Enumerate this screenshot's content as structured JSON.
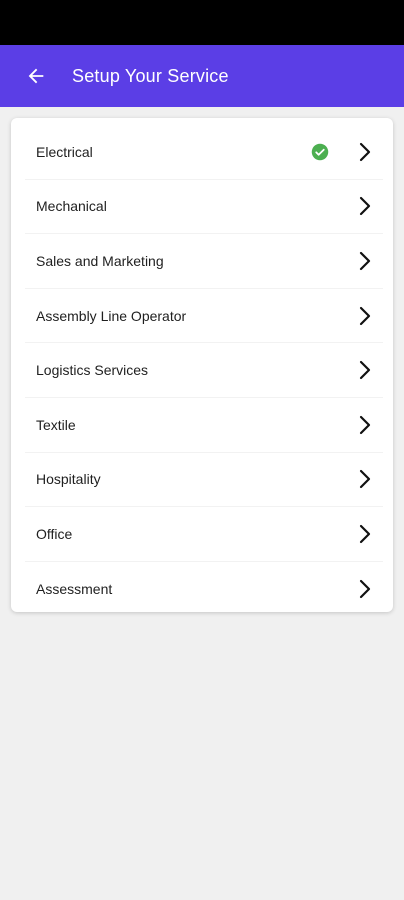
{
  "header": {
    "title": "Setup Your Service",
    "back_icon": "arrow-left-icon",
    "background_color": "#5b3ee6"
  },
  "services": [
    {
      "label": "Electrical",
      "selected": true
    },
    {
      "label": "Mechanical",
      "selected": false
    },
    {
      "label": "Sales and Marketing",
      "selected": false
    },
    {
      "label": "Assembly Line Operator",
      "selected": false
    },
    {
      "label": "Logistics Services",
      "selected": false
    },
    {
      "label": "Textile",
      "selected": false
    },
    {
      "label": "Hospitality",
      "selected": false
    },
    {
      "label": "Office",
      "selected": false
    },
    {
      "label": "Assessment",
      "selected": false
    }
  ],
  "colors": {
    "accent": "#5b3ee6",
    "selected_check": "#4caf50",
    "background": "#f0f0f0"
  }
}
